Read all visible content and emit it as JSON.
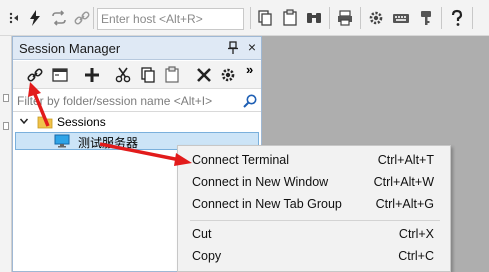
{
  "toolbar": {
    "host_placeholder": "Enter host <Alt+R>",
    "left_icons": [
      "grip-icon",
      "lightning-icon",
      "reconnect-icon",
      "link-icon"
    ],
    "right_icons": [
      "copy-icon",
      "paste-icon",
      "find-icon",
      "print-icon",
      "settings-icon",
      "keyboard-icon",
      "key-icon",
      "help-icon"
    ]
  },
  "panel": {
    "title": "Session Manager",
    "close_glyph": "×",
    "toolbar_icons": [
      "link-icon",
      "window-icon",
      "plus-icon",
      "cut-icon",
      "copy-icon",
      "paste-icon",
      "delete-icon",
      "settings-icon",
      "overflow-icon"
    ],
    "overflow_glyph": "»",
    "filter_placeholder": "Filter by folder/session name <Alt+I>",
    "tree": {
      "root_label": "Sessions",
      "session_label": "测试服务器"
    }
  },
  "context_menu": {
    "items": [
      {
        "label": "Connect Terminal",
        "shortcut": "Ctrl+Alt+T"
      },
      {
        "label": "Connect in New Window",
        "shortcut": "Ctrl+Alt+W"
      },
      {
        "label": "Connect in New Tab Group",
        "shortcut": "Ctrl+Alt+G"
      },
      {
        "label": "Cut",
        "shortcut": "Ctrl+X"
      },
      {
        "label": "Copy",
        "shortcut": "Ctrl+C"
      }
    ]
  },
  "colors": {
    "annotation_arrow": "#e21b1b",
    "panel_header": "#dfe9f5",
    "selection": "#cce4f7",
    "workspace": "#aeaeae"
  }
}
